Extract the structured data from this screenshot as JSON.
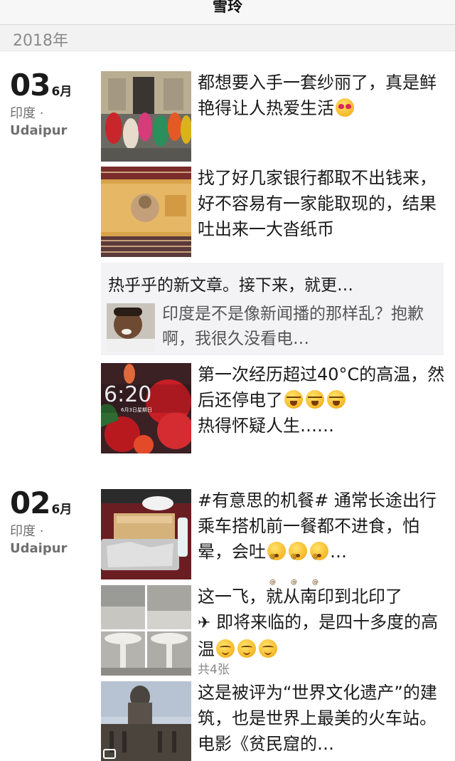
{
  "nav": {
    "title": "雪玲"
  },
  "year": "2018年",
  "days": [
    {
      "day": "03",
      "month": "6月",
      "loc1": "印度 ·",
      "loc2": "Udaipur",
      "posts": [
        {
          "text": "都想要入手一套纱丽了，真是鲜艳得让人热爱生活",
          "thumb": "women-in-saris-photo"
        },
        {
          "text": "找了好几家银行都取不出钱来，好不容易有一家能取现的，结果吐出来一大沓纸币",
          "thumb": "rupee-banknotes-photo"
        },
        {
          "text": "第一次经历超过40°C的高温，然后还停电了",
          "text2": "热得怀疑人生……",
          "thumb": "phone-lockscreen-flowers-photo"
        }
      ],
      "share": {
        "title": "热乎乎的新文章。接下来，就更…",
        "text": "印度是不是像新闻播的那样乱？抱歉啊，我很久没看电…"
      }
    },
    {
      "day": "02",
      "month": "6月",
      "loc1": "印度 ·",
      "loc2": "Udaipur",
      "posts": [
        {
          "text": "#有意思的机餐# 通常长途出行乘车搭机前一餐都不进食，怕晕，会吐",
          "suffix": "…",
          "thumb": "airline-meal-photo"
        },
        {
          "text": "这一飞，就从南印到北印了",
          "text2": " 即将来临的，是四十多度的高温",
          "count": "共4张",
          "thumb": "airport-terminal-collage"
        },
        {
          "text": "这是被评为“世界文化遗产”的建筑，也是世界上最美的火车站。电影《贫民窟的…",
          "thumb": "railway-station-building-photo"
        }
      ]
    }
  ]
}
